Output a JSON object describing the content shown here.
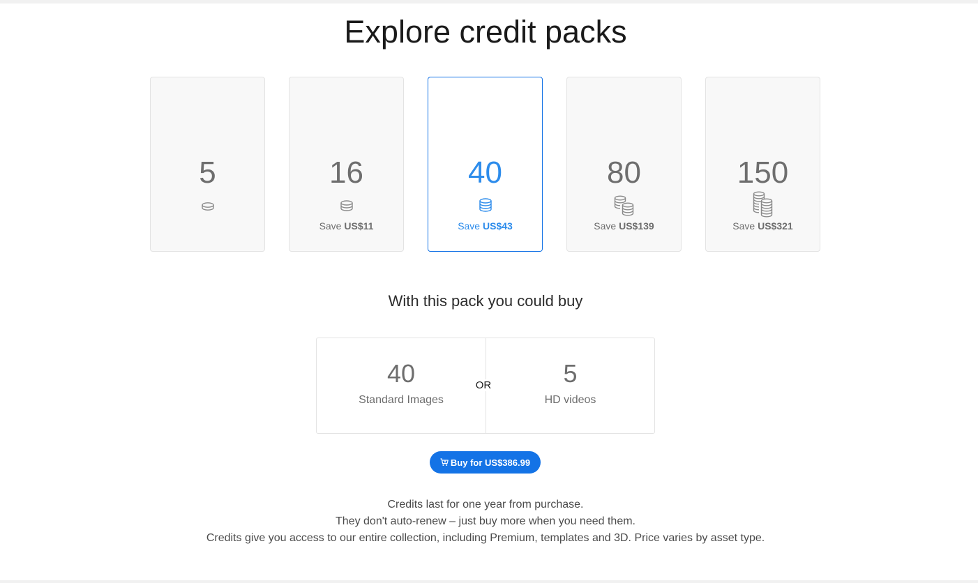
{
  "page": {
    "title": "Explore credit packs"
  },
  "packs": [
    {
      "credits": "5",
      "save_prefix": "",
      "save_amount": "",
      "icon": "single-coin-icon",
      "selected": false
    },
    {
      "credits": "16",
      "save_prefix": "Save ",
      "save_amount": "US$11",
      "icon": "small-coin-stack-icon",
      "selected": false
    },
    {
      "credits": "40",
      "save_prefix": "Save ",
      "save_amount": "US$43",
      "icon": "coin-stack-icon",
      "selected": true
    },
    {
      "credits": "80",
      "save_prefix": "Save ",
      "save_amount": "US$139",
      "icon": "double-coin-stack-icon",
      "selected": false
    },
    {
      "credits": "150",
      "save_prefix": "Save ",
      "save_amount": "US$321",
      "icon": "large-coin-stacks-icon",
      "selected": false
    }
  ],
  "could_buy": {
    "heading": "With this pack you could buy",
    "left": {
      "value": "40",
      "label": "Standard Images"
    },
    "separator": "OR",
    "right": {
      "value": "5",
      "label": "HD videos"
    }
  },
  "buy_button": {
    "label": "Buy for US$386.99",
    "icon": "cart-icon"
  },
  "notes": [
    "Credits last for one year from purchase.",
    "They don't auto-renew – just buy more when you need them.",
    "Credits give you access to our entire collection, including Premium, templates and 3D. Price varies by asset type."
  ],
  "colors": {
    "accent": "#1473e6",
    "selected_text": "#2d8ceb",
    "muted_text": "#6e6e6e"
  }
}
